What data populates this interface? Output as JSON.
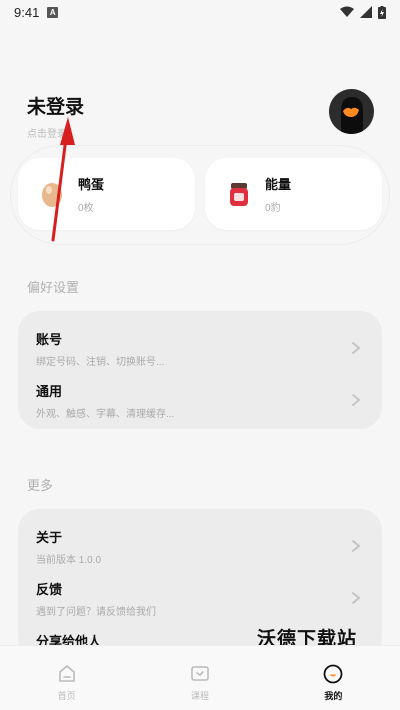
{
  "status_bar": {
    "time": "9:41",
    "notif_badge": "A"
  },
  "profile": {
    "name": "未登录",
    "subtitle": "点击登录"
  },
  "stats": [
    {
      "title": "鸭蛋",
      "value": "0枚",
      "icon": "egg-icon"
    },
    {
      "title": "能量",
      "value": "0豹",
      "icon": "energy-jar-icon"
    }
  ],
  "preferences": {
    "title": "偏好设置",
    "items": [
      {
        "title": "账号",
        "subtitle": "绑定号码、注销、切换账号..."
      },
      {
        "title": "通用",
        "subtitle": "外观、触感、字幕、清理缓存..."
      }
    ]
  },
  "more": {
    "title": "更多",
    "items": [
      {
        "title": "关于",
        "subtitle": "当前版本 1.0.0"
      },
      {
        "title": "反馈",
        "subtitle": "遇到了问题？请反馈给我们"
      },
      {
        "title": "分享给他人",
        "subtitle": ""
      }
    ]
  },
  "watermark": "沃德下载站",
  "bottom_nav": [
    {
      "label": "首页",
      "active": false
    },
    {
      "label": "课程",
      "active": false
    },
    {
      "label": "我的",
      "active": true
    }
  ],
  "colors": {
    "accent": "#ff8a1f",
    "card": "#ffffff",
    "list_bg": "#ececec",
    "annotation_arrow": "#d81f1f"
  }
}
